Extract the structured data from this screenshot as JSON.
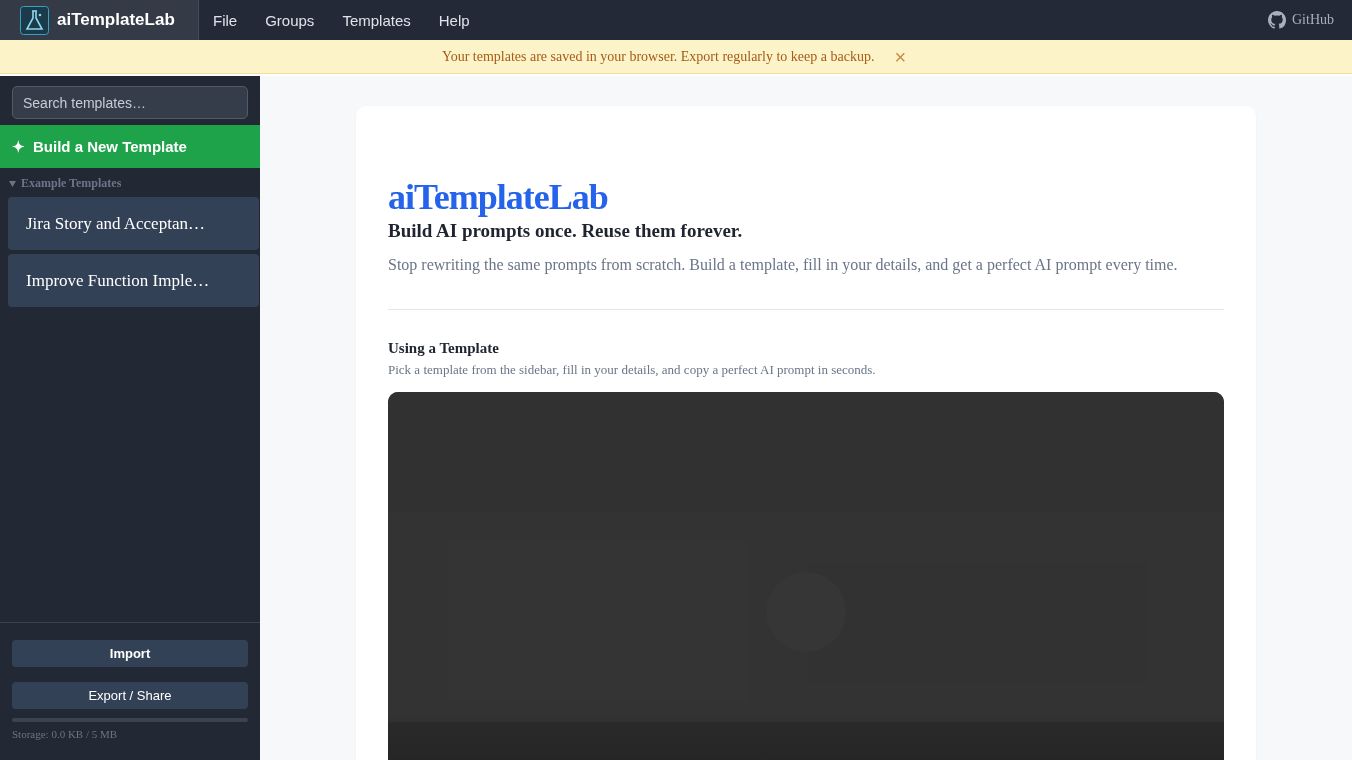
{
  "app": {
    "name": "aiTemplateLab"
  },
  "menu": [
    {
      "label": "File"
    },
    {
      "label": "Groups"
    },
    {
      "label": "Templates"
    },
    {
      "label": "Help"
    }
  ],
  "github": {
    "label": "GitHub"
  },
  "banner": {
    "text": "Your templates are saved in your browser. Export regularly to keep a backup.",
    "close": "×"
  },
  "sidebar": {
    "search": {
      "placeholder": "Search templates…"
    },
    "new_button": {
      "icon": "✦",
      "label": "Build a New Template"
    },
    "group": {
      "label": "Example Templates",
      "expanded": true,
      "items": [
        {
          "label": "Jira Story and Acceptan…"
        },
        {
          "label": "Improve Function Imple…"
        }
      ]
    },
    "import": "Import",
    "export": "Export / Share",
    "storage": {
      "level": 0,
      "text": "Storage: 0.0 KB / 5 MB"
    }
  },
  "main": {
    "title": "aiTemplateLab",
    "tagline": "Build AI prompts once. Reuse them forever.",
    "intro": "Stop rewriting the same prompts from scratch. Build a template, fill in your details, and get a perfect AI prompt every time.",
    "section": {
      "title": "Using a Template",
      "text": "Pick a template from the sidebar, fill in your details, and copy a perfect AI prompt in seconds."
    }
  }
}
